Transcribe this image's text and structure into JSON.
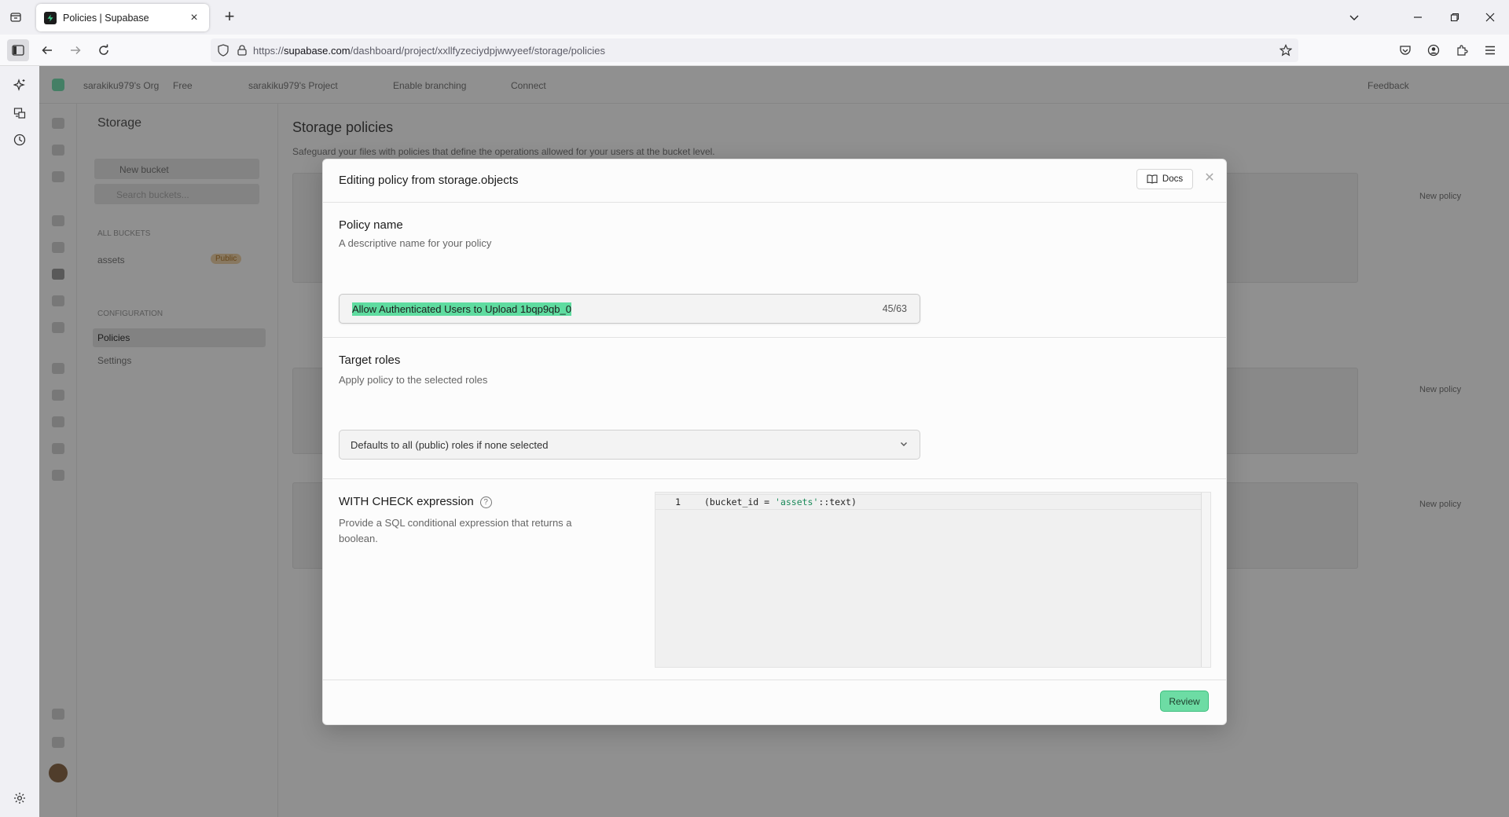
{
  "browser": {
    "tab": {
      "title": "Policies | Supabase"
    },
    "url": {
      "prefix": "https://",
      "domain": "supabase.com",
      "path": "/dashboard/project/xxllfyzeciydpjwwyeef/storage/policies"
    }
  },
  "background": {
    "breadcrumbs": [
      "sarakiku979's Org",
      "Free",
      "sarakiku979's Project",
      "Enable branching",
      "Connect"
    ],
    "feedback_label": "Feedback",
    "sidebar_title": "Storage",
    "new_bucket_label": "New bucket",
    "search_placeholder": "Search buckets...",
    "all_buckets_label": "ALL BUCKETS",
    "bucket_name": "assets",
    "bucket_badge": "Public",
    "configuration_label": "CONFIGURATION",
    "nav_items": [
      "Policies",
      "Settings"
    ],
    "page_title": "Storage policies",
    "page_subtitle": "Safeguard your files with policies that define the operations allowed for your users at the bucket level.",
    "new_policy_label": "New policy"
  },
  "modal": {
    "title": "Editing policy from storage.objects",
    "docs_label": "Docs",
    "policy_name": {
      "title": "Policy name",
      "description": "A descriptive name for your policy",
      "value": "Allow Authenticated Users to Upload 1bqp9qb_0",
      "counter": "45/63"
    },
    "target_roles": {
      "title": "Target roles",
      "description": "Apply policy to the selected roles",
      "placeholder": "Defaults to all (public) roles if none selected"
    },
    "with_check": {
      "title": "WITH CHECK expression",
      "description": "Provide a SQL conditional expression that returns a boolean.",
      "line_number": "1",
      "code_before": "(bucket_id = ",
      "code_string": "'assets'",
      "code_after": "::text)"
    },
    "review_label": "Review"
  }
}
